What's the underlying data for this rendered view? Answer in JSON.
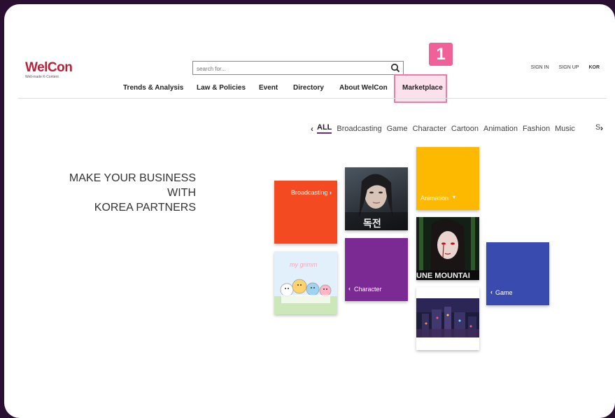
{
  "logo": {
    "name": "WelCon",
    "tagline": "Well-made K-Content"
  },
  "search": {
    "placeholder": "search for..."
  },
  "top_links": {
    "sign_in": "SIGN IN",
    "sign_up": "SIGN UP",
    "lang": "KOR"
  },
  "nav": {
    "items": [
      "Trends & Analysis",
      "Law & Policies",
      "Event",
      "Directory",
      "About WelCon",
      "Marketplace"
    ]
  },
  "annotation": {
    "step": "1"
  },
  "categories": {
    "items": [
      "ALL",
      "Broadcasting",
      "Game",
      "Character",
      "Cartoon",
      "Animation",
      "Fashion",
      "Music"
    ],
    "clipped": "S",
    "active": "ALL"
  },
  "headline": {
    "line1": "MAKE YOUR BUSINESS",
    "line2": "WITH",
    "line3": "KOREA PARTNERS"
  },
  "tiles": {
    "broadcasting": "Broadcasting",
    "animation": "Animation",
    "character": "Character",
    "game": "Game",
    "drama_poster_text": "독전",
    "webtoon_poster_text": "UNE MOUNTAI",
    "character_art_text": "my grimm"
  },
  "colors": {
    "brand_red": "#b5233a",
    "broadcasting": "#f44a22",
    "animation": "#fcb900",
    "character": "#7b2a93",
    "game": "#3a4bb0",
    "accent_pink": "#f0619a"
  }
}
